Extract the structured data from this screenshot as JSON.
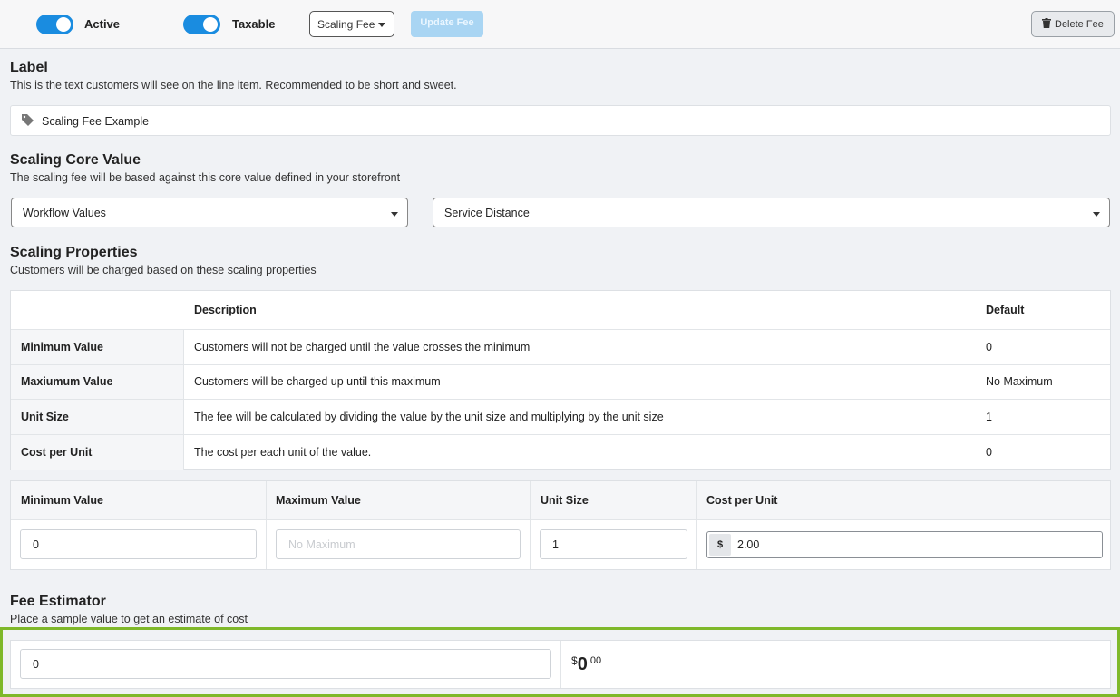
{
  "toolbar": {
    "active_label": "Active",
    "taxable_label": "Taxable",
    "fee_type": "Scaling Fee",
    "update_label": "Update Fee",
    "delete_label": "Delete Fee",
    "active_on": true,
    "taxable_on": true,
    "accent_color": "#1a8ce0"
  },
  "label_section": {
    "title": "Label",
    "subtitle": "This is the text customers will see on the line item. Recommended to be short and sweet.",
    "value": "Scaling Fee Example",
    "icon": "tag-icon"
  },
  "core_section": {
    "title": "Scaling Core Value",
    "subtitle": "The scaling fee will be based against this core value defined in your storefront",
    "source_value": "Workflow Values",
    "field_value": "Service Distance"
  },
  "properties_section": {
    "title": "Scaling Properties",
    "subtitle": "Customers will be charged based on these scaling properties",
    "columns": [
      "",
      "Description",
      "Default"
    ],
    "rows": [
      {
        "name": "Minimum Value",
        "description": "Customers will not be charged until the value crosses the minimum",
        "default": "0"
      },
      {
        "name": "Maxiumum Value",
        "description": "Customers will be charged up until this maximum",
        "default": "No Maximum"
      },
      {
        "name": "Unit Size",
        "description": "The fee will be calculated by dividing the value by the unit size and multiplying by the unit size",
        "default": "1"
      },
      {
        "name": "Cost per Unit",
        "description": "The cost per each unit of the value.",
        "default": "0"
      }
    ]
  },
  "values_table": {
    "columns": [
      "Minimum Value",
      "Maximum Value",
      "Unit Size",
      "Cost per Unit"
    ],
    "min_value": "0",
    "max_placeholder": "No Maximum",
    "unit_size": "1",
    "currency_symbol": "$",
    "cost_per_unit": "2.00"
  },
  "estimator": {
    "title": "Fee Estimator",
    "subtitle": "Place a sample value to get an estimate of cost",
    "sample_value": "0",
    "currency": "$",
    "amount_whole": "0",
    "amount_cents": ".00",
    "highlight_color": "#7fb82a"
  }
}
